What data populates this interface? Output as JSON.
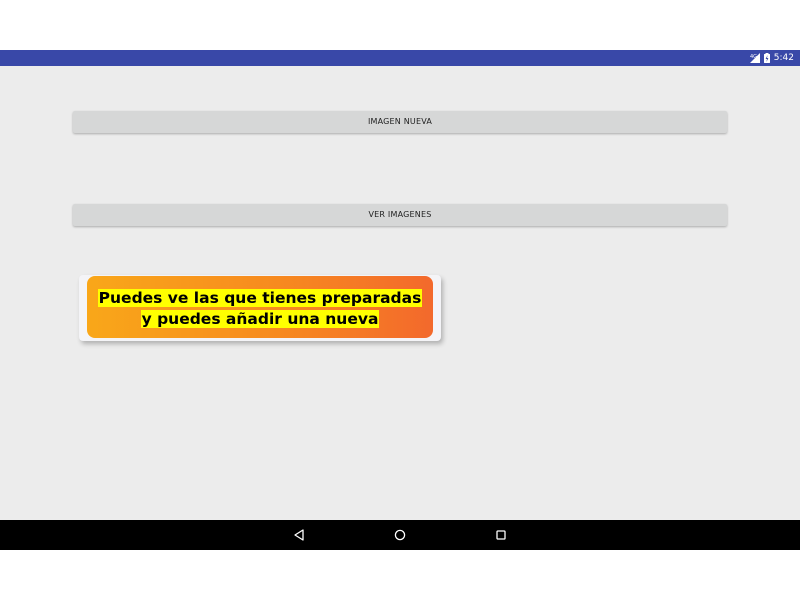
{
  "status_bar": {
    "time": "5:42",
    "icons": [
      "signal-icon",
      "battery-icon"
    ],
    "color": "#3948a8"
  },
  "buttons": {
    "new_image_label": "IMAGEN NUEVA",
    "view_images_label": "VER IMAGENES"
  },
  "info_card": {
    "line1": "Puedes ve las que tienes preparadas",
    "line2": "y puedes añadir una nueva",
    "highlight_color": "#ffff00",
    "gradient_colors": [
      "#f9a719",
      "#f3692c"
    ]
  },
  "nav_bar": {
    "icons": [
      "back-icon",
      "home-icon",
      "recents-icon"
    ]
  }
}
